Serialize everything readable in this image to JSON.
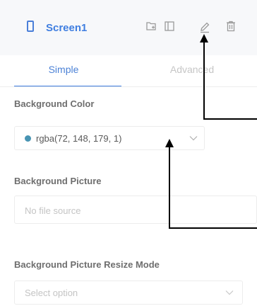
{
  "header": {
    "title": "Screen1",
    "accent_color": "#3f7ee0",
    "icons": [
      "screen-icon",
      "add-page-icon",
      "layout-icon",
      "edit-icon",
      "delete-icon"
    ]
  },
  "tabs": [
    {
      "label": "Simple",
      "active": true
    },
    {
      "label": "Advanced",
      "active": false
    }
  ],
  "fields": {
    "background_color": {
      "label": "Background Color",
      "value": "rgba(72, 148, 179, 1)",
      "swatch": "#4894b3"
    },
    "background_picture": {
      "label": "Background Picture",
      "placeholder": "No file source"
    },
    "resize_mode": {
      "label": "Background Picture Resize Mode",
      "placeholder": "Select option"
    }
  }
}
